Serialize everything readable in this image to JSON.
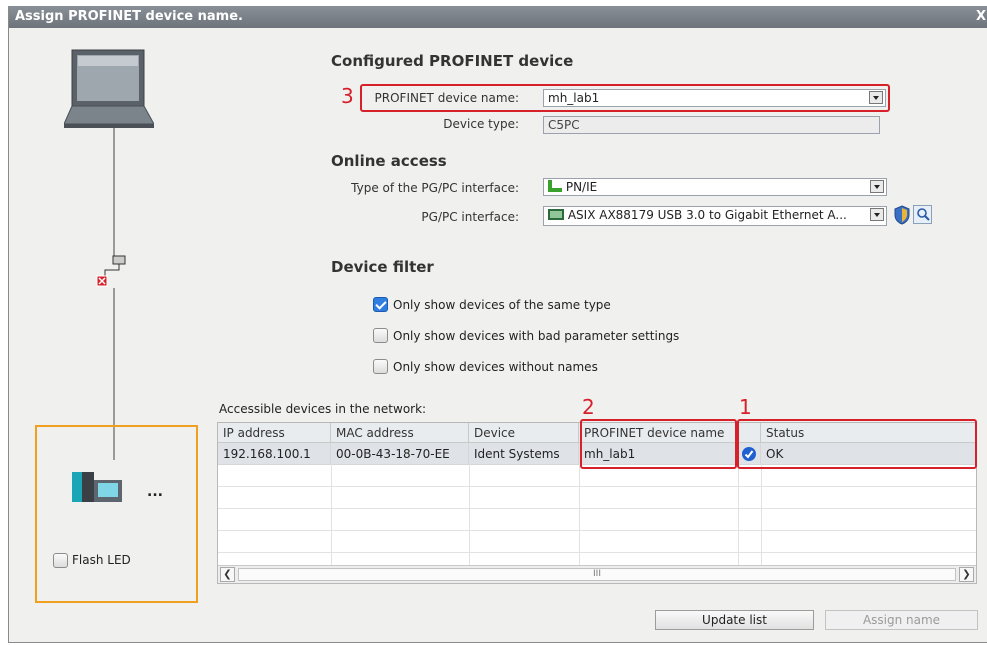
{
  "window": {
    "title": "Assign PROFINET device name.",
    "close_glyph": "X"
  },
  "configured": {
    "heading": "Configured PROFINET device",
    "name_label": "PROFINET device name:",
    "name_value": "mh_lab1",
    "type_label": "Device type:",
    "type_value": "C5PC"
  },
  "online": {
    "heading": "Online access",
    "iface_type_label": "Type of the PG/PC interface:",
    "iface_type_value": "PN/IE",
    "iface_label": "PG/PC interface:",
    "iface_value": "ASIX AX88179 USB 3.0 to Gigabit Ethernet A..."
  },
  "filter": {
    "heading": "Device filter",
    "options": [
      {
        "label": "Only show devices of the same type",
        "checked": true
      },
      {
        "label": "Only show devices with bad parameter settings",
        "checked": false
      },
      {
        "label": "Only show devices without names",
        "checked": false
      }
    ]
  },
  "table": {
    "caption": "Accessible devices in the network:",
    "columns": [
      "IP address",
      "MAC address",
      "Device",
      "PROFINET device name",
      "",
      "Status"
    ],
    "rows": [
      {
        "ip": "192.168.100.1",
        "mac": "00-0B-43-18-70-EE",
        "device": "Ident Systems",
        "name": "mh_lab1",
        "status": "OK"
      }
    ],
    "scroll_thumb": "III"
  },
  "annotations": {
    "one": "1",
    "two": "2",
    "three": "3"
  },
  "left": {
    "flash_led_label": "Flash LED",
    "device_more": "..."
  },
  "buttons": {
    "update": "Update list",
    "assign": "Assign name"
  },
  "colors": {
    "annotation_red": "#d6202a",
    "highlight_orange": "#f0a020",
    "check_blue": "#2f7ee0"
  }
}
